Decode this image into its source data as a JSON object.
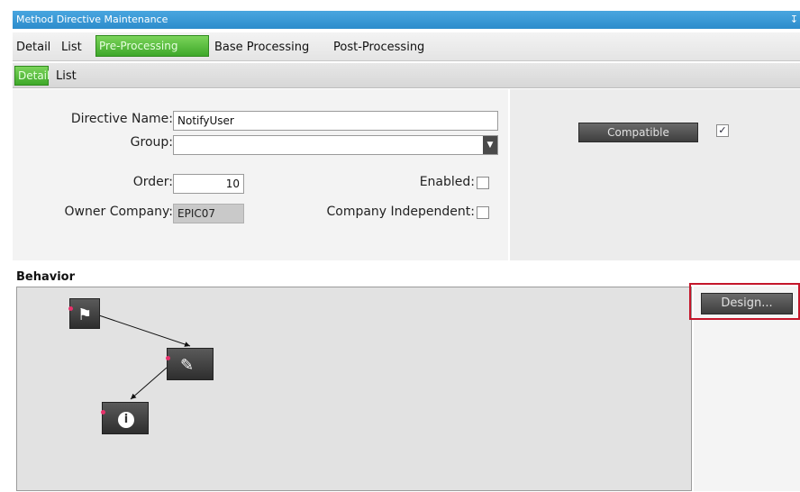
{
  "window": {
    "title": "Method Directive Maintenance",
    "pin_icon": "pin-icon"
  },
  "main_tabs": [
    {
      "label": "Detail"
    },
    {
      "label": "List"
    },
    {
      "label": "Pre-Processing",
      "active": true
    },
    {
      "label": "Base Processing"
    },
    {
      "label": "Post-Processing"
    }
  ],
  "sub_tabs": [
    {
      "label": "Detail",
      "active": true
    },
    {
      "label": "List"
    }
  ],
  "form": {
    "directive_name_label": "Directive Name:",
    "directive_name_value": "NotifyUser",
    "group_label": "Group:",
    "group_value": "",
    "order_label": "Order:",
    "order_value": "10",
    "enabled_label": "Enabled:",
    "enabled_checked": false,
    "owner_company_label": "Owner Company:",
    "owner_company_value": "EPIC07",
    "company_independent_label": "Company Independent:",
    "company_independent_checked": false
  },
  "compatibility": {
    "button_label": "Compatible",
    "checked": true,
    "check_glyph": "✓"
  },
  "behavior": {
    "label": "Behavior",
    "design_button_label": "Design...",
    "nodes": [
      {
        "kind": "start",
        "icon": "flag-icon"
      },
      {
        "kind": "action",
        "icon": "edit-icon"
      },
      {
        "kind": "message",
        "icon": "info-icon"
      }
    ]
  },
  "colors": {
    "title_bar": "#2c8ccc",
    "active_tab": "#3ea82a",
    "highlight": "#c4162a"
  }
}
